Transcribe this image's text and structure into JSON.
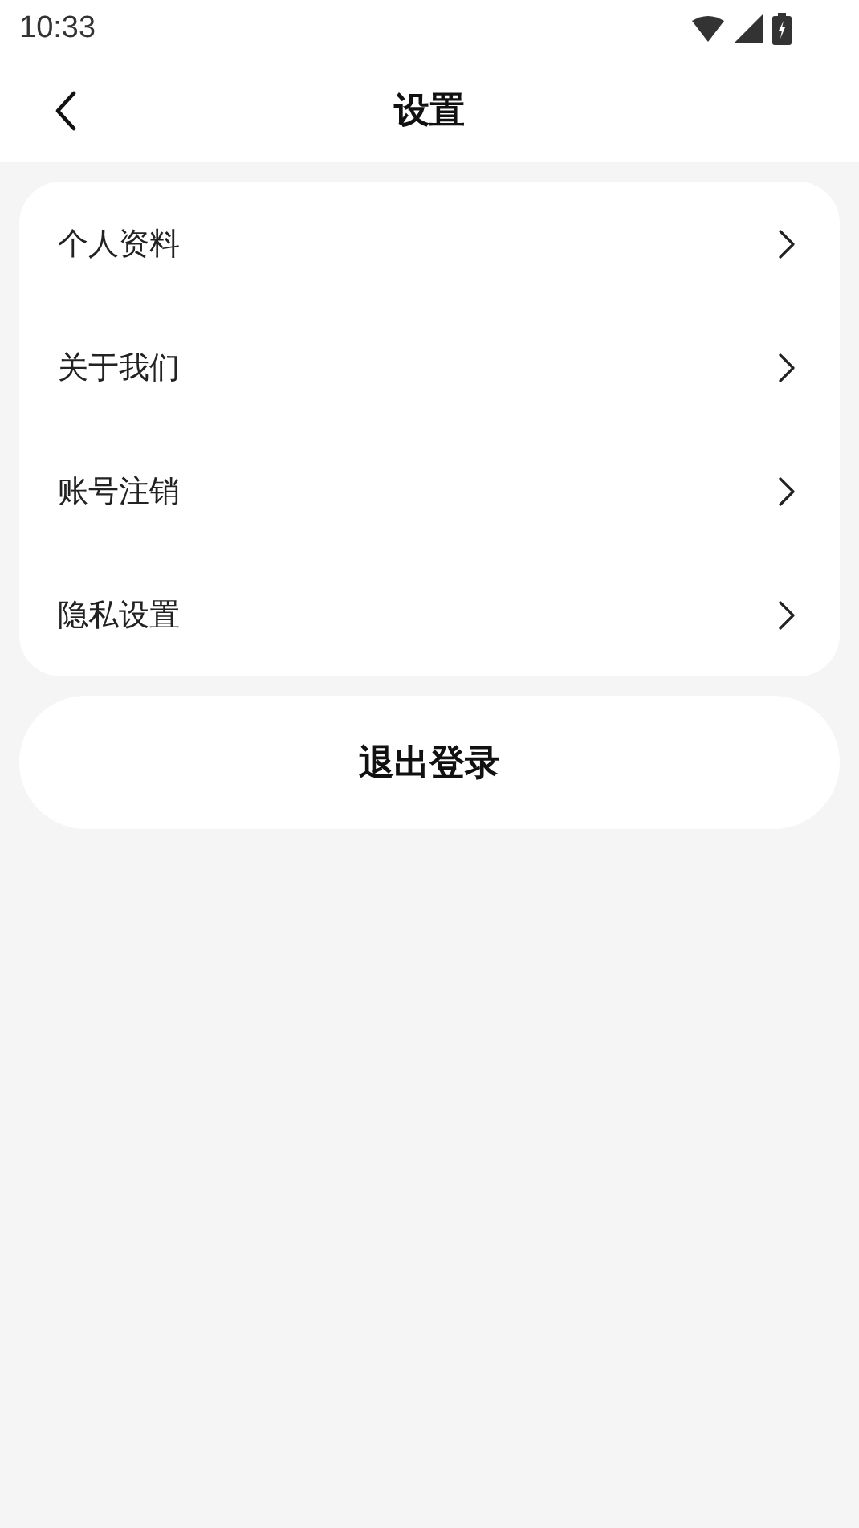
{
  "status_bar": {
    "time": "10:33"
  },
  "header": {
    "title": "设置"
  },
  "menu": [
    {
      "label": "个人资料"
    },
    {
      "label": "关于我们"
    },
    {
      "label": "账号注销"
    },
    {
      "label": "隐私设置"
    }
  ],
  "logout": {
    "label": "退出登录"
  }
}
